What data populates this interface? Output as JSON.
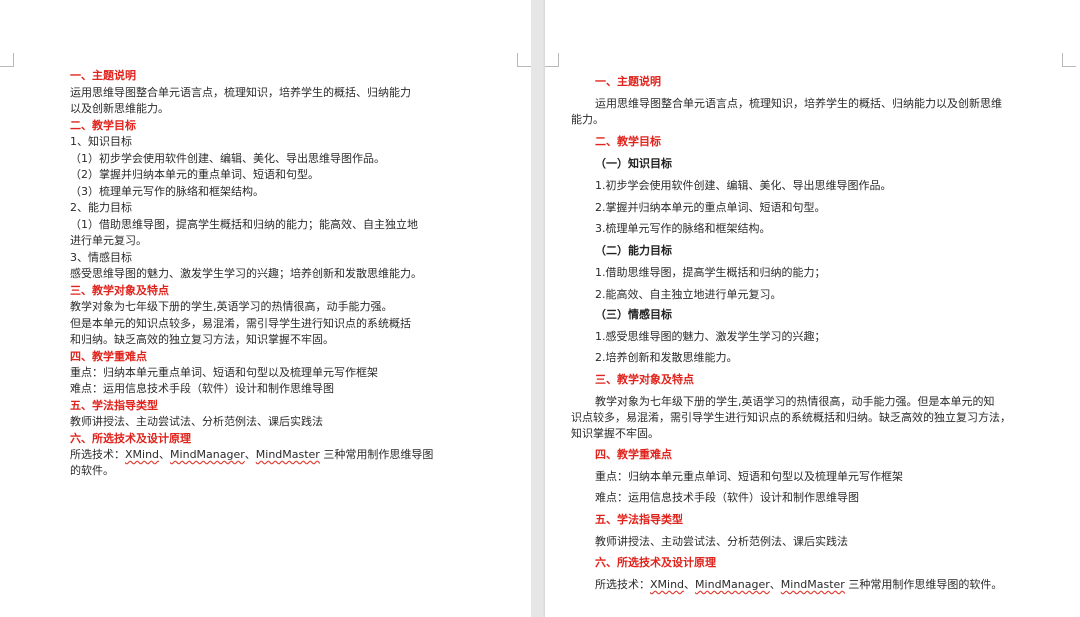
{
  "left_page": {
    "lines": [
      "一、主题说明",
      " 运用思维导图整合单元语言点，梳理知识，培养学生的概括、归纳能力",
      "以及创新思维能力。",
      "二、教学目标",
      "1、知识目标",
      "（1）初步学会使用软件创建、编辑、美化、导出思维导图作品。",
      "（2）掌握并归纳本单元的重点单词、短语和句型。",
      "（3）梳理单元写作的脉络和框架结构。",
      "2、能力目标",
      "（1）借助思维导图，提高学生概括和归纳的能力；能高效、自主独立地",
      "进行单元复习。",
      "3、情感目标",
      "感受思维导图的魅力、激发学生学习的兴趣；培养创新和发散思维能力。",
      "三、教学对象及特点",
      "        教学对象为七年级下册的学生,英语学习的热情很高，动手能力强。",
      "但是本单元的知识点较多，易混淆，需引导学生进行知识点的系统概括",
      "和归纳。缺乏高效的独立复习方法，知识掌握不牢固。",
      "四、教学重难点",
      "重点：归纳本单元重点单词、短语和句型以及梳理单元写作框架",
      "难点：运用信息技术手段（软件）设计和制作思维导图",
      "五、学法指导类型",
      "教师讲授法、主动尝试法、分析范例法、课后实践法",
      "六、所选技术及设计原理"
    ],
    "tech_line": {
      "prefix": " 所选技术：",
      "t1": "XMind",
      "sep1": "、",
      "t2": "MindManager",
      "sep2": "、",
      "t3": "MindMaster",
      "suffix": " 三种常用制作思维导图"
    },
    "tech_line2": "的软件。"
  },
  "right_page": {
    "lines": [
      "一、主题说明",
      "运用思维导图整合单元语言点，梳理知识，培养学生的概括、归纳能力以及创新思维",
      "能力。",
      "二、教学目标",
      "（一）知识目标",
      "1.初步学会使用软件创建、编辑、美化、导出思维导图作品。",
      "2.掌握并归纳本单元的重点单词、短语和句型。",
      "3.梳理单元写作的脉络和框架结构。",
      "（二）能力目标",
      "1.借助思维导图，提高学生概括和归纳的能力；",
      "2.能高效、自主独立地进行单元复习。",
      "（三）情感目标",
      "1.感受思维导图的魅力、激发学生学习的兴趣；",
      "2.培养创新和发散思维能力。",
      "三、教学对象及特点",
      "教学对象为七年级下册的学生,英语学习的热情很高，动手能力强。但是本单元的知",
      "识点较多，易混淆，需引导学生进行知识点的系统概括和归纳。缺乏高效的独立复习方法，",
      "知识掌握不牢固。",
      "四、教学重难点",
      "重点：归纳本单元重点单词、短语和句型以及梳理单元写作框架",
      "难点：运用信息技术手段（软件）设计和制作思维导图",
      "五、学法指导类型",
      "教师讲授法、主动尝试法、分析范例法、课后实践法",
      "六、所选技术及设计原理"
    ],
    "tech_line": {
      "prefix": "所选技术：",
      "t1": "XMind",
      "sep1": "、",
      "t2": "MindManager",
      "sep2": "、",
      "t3": "MindMaster",
      "suffix": " 三种常用制作思维导图的软件。"
    }
  }
}
